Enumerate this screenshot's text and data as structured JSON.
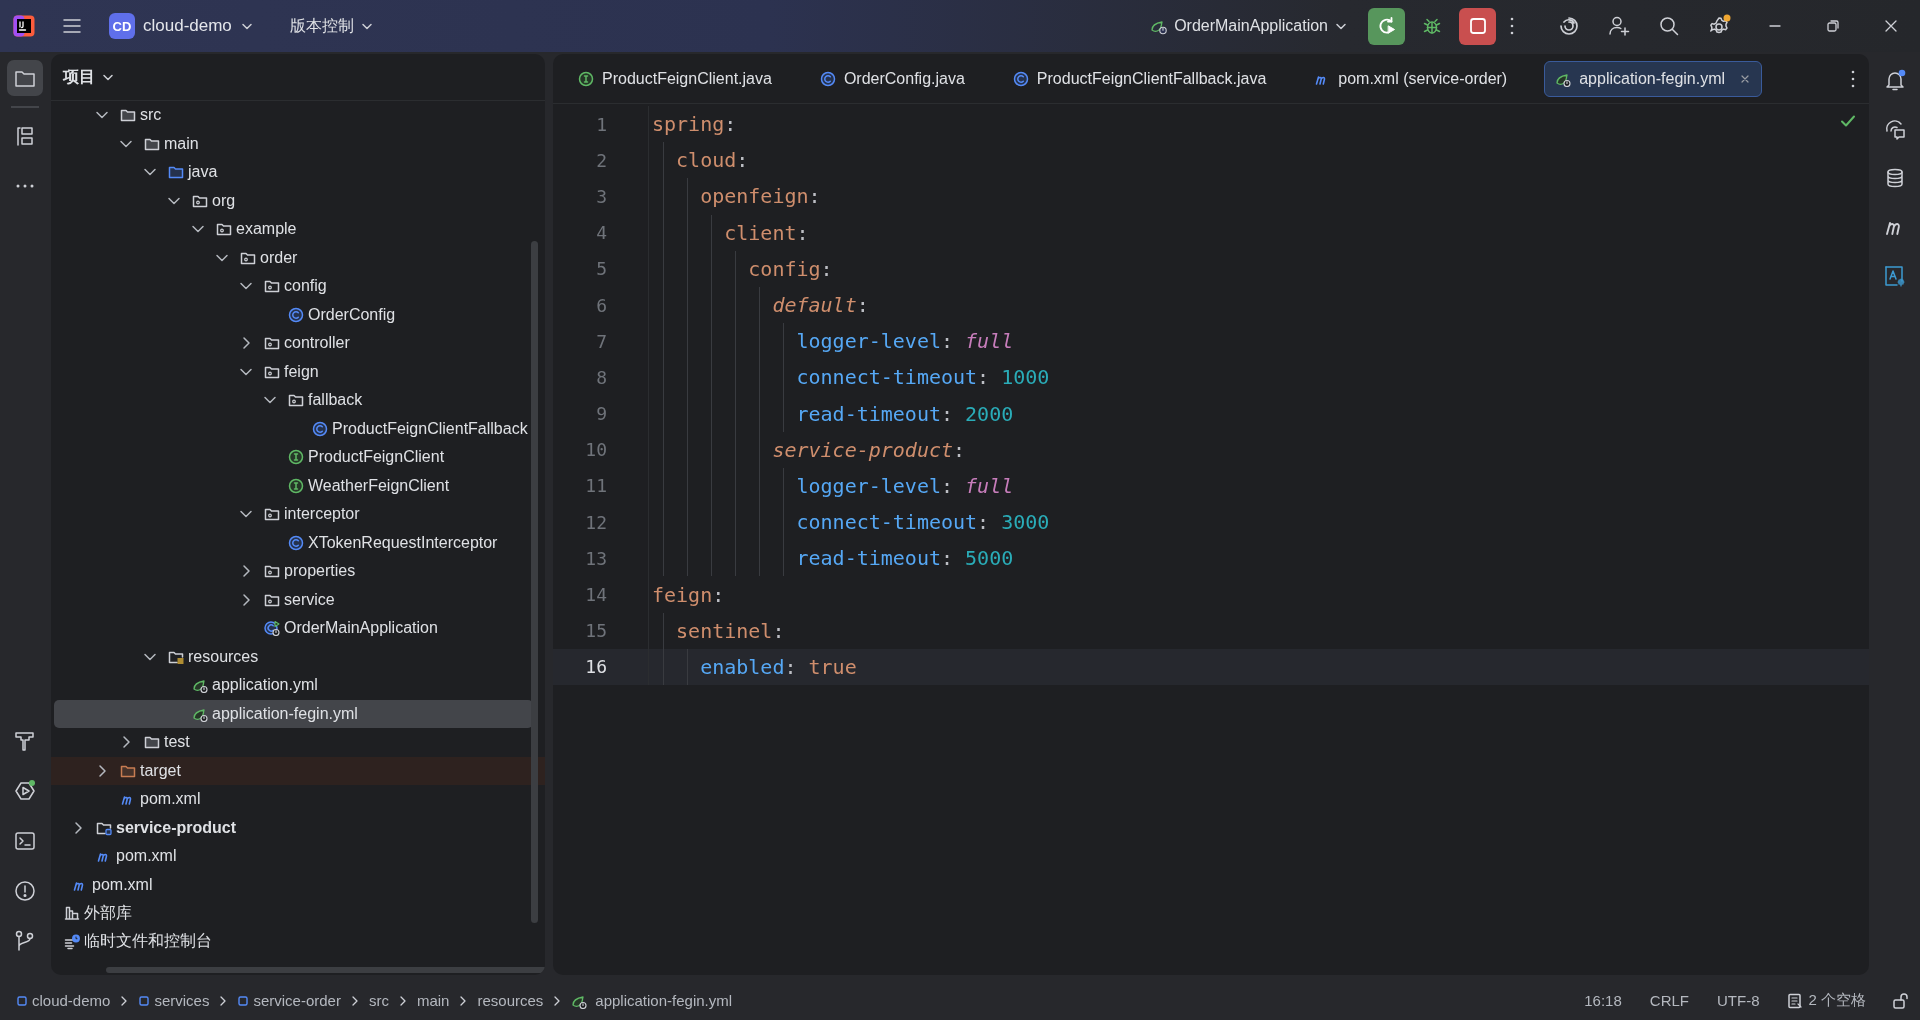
{
  "title_bar": {
    "project": {
      "badge": "CD",
      "name": "cloud-demo"
    },
    "vcs": "版本控制",
    "run_config": "OrderMainApplication"
  },
  "left_tools": [
    {
      "kind": "project",
      "selected": true
    },
    {
      "kind": "structure",
      "selected": false
    },
    {
      "kind": "more",
      "selected": false
    }
  ],
  "left_tools_bottom": [
    {
      "kind": "build",
      "selected": false
    },
    {
      "kind": "services",
      "selected": false
    },
    {
      "kind": "terminal",
      "selected": false
    },
    {
      "kind": "problems",
      "selected": false
    },
    {
      "kind": "git",
      "selected": false
    }
  ],
  "project_panel": {
    "title": "项目",
    "tree": [
      {
        "children": [
          {
            "children": [
              {
                "children": [
                  {
                    "label": "src",
                    "kind": "folder",
                    "selected": false,
                    "expanded": true,
                    "children": [
                      {
                        "label": "main",
                        "kind": "folder",
                        "selected": false,
                        "expanded": true,
                        "children": [
                          {
                            "label": "java",
                            "kind": "source-root",
                            "selected": false,
                            "expanded": true,
                            "children": [
                              {
                                "label": "org",
                                "kind": "package",
                                "selected": false,
                                "expanded": true,
                                "children": [
                                  {
                                    "label": "example",
                                    "kind": "package",
                                    "selected": false,
                                    "expanded": true,
                                    "children": [
                                      {
                                        "label": "order",
                                        "kind": "package",
                                        "selected": false,
                                        "expanded": true,
                                        "children": [
                                          {
                                            "label": "config",
                                            "kind": "package",
                                            "selected": false,
                                            "expanded": true,
                                            "children": [
                                              {
                                                "label": "OrderConfig",
                                                "kind": "class",
                                                "selected": false
                                              }
                                            ]
                                          },
                                          {
                                            "label": "controller",
                                            "kind": "package",
                                            "selected": false,
                                            "expanded": false
                                          },
                                          {
                                            "label": "feign",
                                            "kind": "package",
                                            "selected": false,
                                            "expanded": true,
                                            "children": [
                                              {
                                                "label": "fallback",
                                                "kind": "package",
                                                "selected": false,
                                                "expanded": true,
                                                "children": [
                                                  {
                                                    "label": "ProductFeignClientFallback",
                                                    "kind": "class",
                                                    "selected": false
                                                  }
                                                ]
                                              },
                                              {
                                                "label": "ProductFeignClient",
                                                "kind": "interface",
                                                "selected": false
                                              },
                                              {
                                                "label": "WeatherFeignClient",
                                                "kind": "interface",
                                                "selected": false
                                              }
                                            ]
                                          },
                                          {
                                            "label": "interceptor",
                                            "kind": "package",
                                            "selected": false,
                                            "expanded": true,
                                            "children": [
                                              {
                                                "label": "XTokenRequestInterceptor",
                                                "kind": "class",
                                                "selected": false
                                              }
                                            ]
                                          },
                                          {
                                            "label": "properties",
                                            "kind": "package",
                                            "selected": false,
                                            "expanded": false
                                          },
                                          {
                                            "label": "service",
                                            "kind": "package",
                                            "selected": false,
                                            "expanded": false
                                          },
                                          {
                                            "label": "OrderMainApplication",
                                            "kind": "spring-app",
                                            "selected": false
                                          }
                                        ]
                                      }
                                    ]
                                  }
                                ]
                              }
                            ]
                          },
                          {
                            "label": "resources",
                            "kind": "resources-root",
                            "selected": false,
                            "expanded": true,
                            "children": [
                              {
                                "label": "application.yml",
                                "kind": "spring-yml",
                                "selected": false
                              },
                              {
                                "label": "application-fegin.yml",
                                "kind": "spring-yml",
                                "selected": true
                              }
                            ]
                          }
                        ]
                      },
                      {
                        "label": "test",
                        "kind": "folder",
                        "selected": false,
                        "expanded": false
                      }
                    ]
                  },
                  {
                    "label": "target",
                    "kind": "excluded",
                    "selected": false,
                    "expanded": false
                  },
                  {
                    "label": "pom.xml",
                    "kind": "maven",
                    "selected": false
                  }
                ]
              },
              {
                "label": "service-product",
                "kind": "module",
                "selected": false,
                "expanded": false
              },
              {
                "label": "pom.xml",
                "kind": "maven",
                "selected": false
              }
            ]
          },
          {
            "label": "pom.xml",
            "kind": "maven",
            "selected": false
          }
        ]
      },
      {
        "label": "外部库",
        "kind": "library",
        "selected": false
      },
      {
        "label": "临时文件和控制台",
        "kind": "scratch",
        "selected": false
      }
    ]
  },
  "tabs": [
    {
      "label": "ProductFeignClient.java",
      "kind": "interface",
      "selected": false
    },
    {
      "label": "OrderConfig.java",
      "kind": "class",
      "selected": false
    },
    {
      "label": "ProductFeignClientFallback.java",
      "kind": "class",
      "selected": false
    },
    {
      "label": "pom.xml (service-order)",
      "kind": "maven",
      "selected": false
    },
    {
      "label": "application-fegin.yml",
      "kind": "spring-yml",
      "selected": true
    }
  ],
  "editor": {
    "lines": [
      {
        "number": "1",
        "current": false,
        "tokens": [
          {
            "kind": "key",
            "text": "spring"
          },
          {
            "kind": "punct",
            "text": ":"
          }
        ],
        "children": [
          {
            "number": "2",
            "current": false,
            "tokens": [
              {
                "kind": "key",
                "text": "cloud"
              },
              {
                "kind": "punct",
                "text": ":"
              }
            ],
            "children": [
              {
                "number": "3",
                "current": false,
                "tokens": [
                  {
                    "kind": "key",
                    "text": "openfeign"
                  },
                  {
                    "kind": "punct",
                    "text": ":"
                  }
                ],
                "children": [
                  {
                    "number": "4",
                    "current": false,
                    "tokens": [
                      {
                        "kind": "key",
                        "text": "client"
                      },
                      {
                        "kind": "punct",
                        "text": ":"
                      }
                    ],
                    "children": [
                      {
                        "number": "5",
                        "current": false,
                        "tokens": [
                          {
                            "kind": "key",
                            "text": "config"
                          },
                          {
                            "kind": "punct",
                            "text": ":"
                          }
                        ],
                        "children": [
                          {
                            "number": "6",
                            "current": false,
                            "tokens": [
                              {
                                "kind": "map-key",
                                "text": "default"
                              },
                              {
                                "kind": "punct",
                                "text": ":"
                              }
                            ],
                            "children": [
                              {
                                "number": "7",
                                "current": false,
                                "tokens": [
                                  {
                                    "kind": "property",
                                    "text": "logger-level"
                                  },
                                  {
                                    "kind": "punct",
                                    "text": ":"
                                  },
                                  {
                                    "kind": "enum",
                                    "text": "full"
                                  }
                                ]
                              },
                              {
                                "number": "8",
                                "current": false,
                                "tokens": [
                                  {
                                    "kind": "property",
                                    "text": "connect-timeout"
                                  },
                                  {
                                    "kind": "punct",
                                    "text": ":"
                                  },
                                  {
                                    "kind": "number",
                                    "text": "1000"
                                  }
                                ]
                              },
                              {
                                "number": "9",
                                "current": false,
                                "tokens": [
                                  {
                                    "kind": "property",
                                    "text": "read-timeout"
                                  },
                                  {
                                    "kind": "punct",
                                    "text": ":"
                                  },
                                  {
                                    "kind": "number",
                                    "text": "2000"
                                  }
                                ]
                              }
                            ]
                          },
                          {
                            "number": "10",
                            "current": false,
                            "tokens": [
                              {
                                "kind": "map-key",
                                "text": "service-product"
                              },
                              {
                                "kind": "punct",
                                "text": ":"
                              }
                            ],
                            "children": [
                              {
                                "number": "11",
                                "current": false,
                                "tokens": [
                                  {
                                    "kind": "property",
                                    "text": "logger-level"
                                  },
                                  {
                                    "kind": "punct",
                                    "text": ":"
                                  },
                                  {
                                    "kind": "enum",
                                    "text": "full"
                                  }
                                ]
                              },
                              {
                                "number": "12",
                                "current": false,
                                "tokens": [
                                  {
                                    "kind": "property",
                                    "text": "connect-timeout"
                                  },
                                  {
                                    "kind": "punct",
                                    "text": ":"
                                  },
                                  {
                                    "kind": "number",
                                    "text": "3000"
                                  }
                                ]
                              },
                              {
                                "number": "13",
                                "current": false,
                                "tokens": [
                                  {
                                    "kind": "property",
                                    "text": "read-timeout"
                                  },
                                  {
                                    "kind": "punct",
                                    "text": ":"
                                  },
                                  {
                                    "kind": "number",
                                    "text": "5000"
                                  }
                                ]
                              }
                            ]
                          }
                        ]
                      }
                    ]
                  }
                ]
              }
            ]
          }
        ]
      },
      {
        "number": "14",
        "current": false,
        "tokens": [
          {
            "kind": "key",
            "text": "feign"
          },
          {
            "kind": "punct",
            "text": ":"
          }
        ],
        "children": [
          {
            "number": "15",
            "current": false,
            "tokens": [
              {
                "kind": "key",
                "text": "sentinel"
              },
              {
                "kind": "punct",
                "text": ":"
              }
            ],
            "children": [
              {
                "number": "16",
                "current": true,
                "tokens": [
                  {
                    "kind": "property",
                    "text": "enabled"
                  },
                  {
                    "kind": "punct",
                    "text": ":"
                  },
                  {
                    "kind": "keyword",
                    "text": "true"
                  }
                ]
              }
            ]
          }
        ]
      }
    ]
  },
  "status_bar": {
    "breadcrumbs": [
      {
        "label": "cloud-demo",
        "kind": "module"
      },
      {
        "label": "services",
        "kind": "module"
      },
      {
        "label": "service-order",
        "kind": "module"
      },
      {
        "label": "src",
        "kind": "folder"
      },
      {
        "label": "main",
        "kind": "folder"
      },
      {
        "label": "resources",
        "kind": "folder"
      },
      {
        "label": "application-fegin.yml",
        "kind": "spring-yml"
      }
    ],
    "position": "16:18",
    "line_separator": "CRLF",
    "encoding": "UTF-8",
    "indent": "2 个空格"
  }
}
